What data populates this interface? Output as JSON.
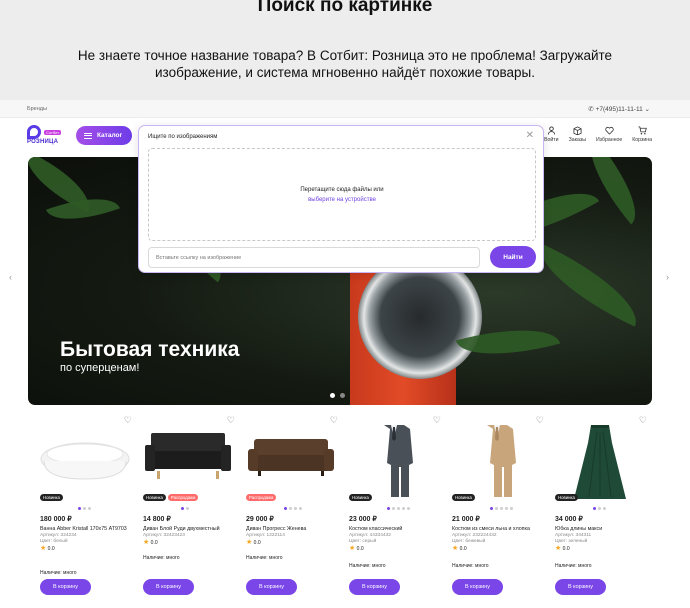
{
  "promo": {
    "title": "Поиск по картинке",
    "text": "Не знаете точное название товара? В Сотбит: Розница это не проблема! Загружайте изображение, и система мгновенно найдёт похожие товары."
  },
  "topbar": {
    "brands": "Бренды",
    "phone": "+7(495)11-11-11"
  },
  "header": {
    "logo_name": "РОЗНИЦА",
    "logo_tag": "Сотбит",
    "catalog": "Каталог",
    "icons": [
      {
        "label": "Войти",
        "icon": "user-icon"
      },
      {
        "label": "Заказы",
        "icon": "box-icon"
      },
      {
        "label": "Избранное",
        "icon": "heart-icon"
      },
      {
        "label": "Корзина",
        "icon": "cart-icon"
      }
    ]
  },
  "banner": {
    "title": "Бытовая техника",
    "subtitle": "по суперценам!"
  },
  "modal": {
    "title": "Ищите по изображениям",
    "drop_text": "Перетащите сюда файлы или",
    "drop_link": "выберите на устройстве",
    "url_placeholder": "Вставьте ссылку на изображение",
    "button": "Найти"
  },
  "products": [
    {
      "price": "180 000 ₽",
      "name": "Ванна Abber Kristall 170х75 AT9703",
      "article": "Артикул: 324234",
      "color": "Цвет: белый",
      "rating": "0.0",
      "badges": [
        "Новинка"
      ],
      "avail": "Наличие: много",
      "cart": "В корзину"
    },
    {
      "price": "14 800 ₽",
      "name": "Диван Блой Руди двухместный",
      "article": "Артикул: 32423423",
      "color": "",
      "rating": "0.0",
      "badges": [
        "Новинка",
        "Распродажа"
      ],
      "avail": "Наличие: много",
      "cart": "В корзину"
    },
    {
      "price": "29 000 ₽",
      "name": "Диван Прогресс Женева",
      "article": "Артикул: 1222114",
      "color": "",
      "rating": "0.0",
      "badges": [
        "Распродажа"
      ],
      "avail": "Наличие: много",
      "cart": "В корзину"
    },
    {
      "price": "23 000 ₽",
      "name": "Костюм классический",
      "article": "Артикул: 44334432",
      "color": "Цвет: серый",
      "rating": "0.0",
      "badges": [
        "Новинка"
      ],
      "avail": "Наличие: много",
      "cart": "В корзину"
    },
    {
      "price": "21 000 ₽",
      "name": "Костюм из смеси льна и хлопка",
      "article": "Артикул: 232224432",
      "color": "Цвет: бежевый",
      "rating": "0.0",
      "badges": [
        "Новинка"
      ],
      "avail": "Наличие: много",
      "cart": "В корзину"
    },
    {
      "price": "34 000 ₽",
      "name": "Юбка длины макси",
      "article": "Артикул: 344311",
      "color": "Цвет: зеленый",
      "rating": "0.0",
      "badges": [
        "Новинка"
      ],
      "avail": "Наличие: много",
      "cart": "В корзину"
    }
  ],
  "colors": {
    "accent": "#7a46e8",
    "sale": "#ff6b6b",
    "banner_bg": "#141a12"
  }
}
